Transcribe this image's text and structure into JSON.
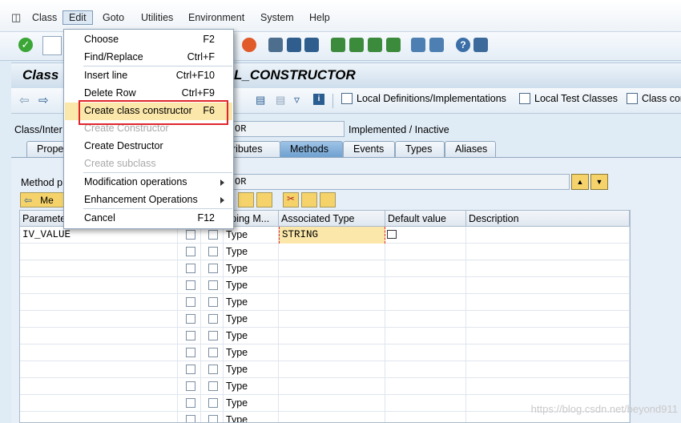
{
  "menubar": {
    "items": [
      "Class",
      "Edit",
      "Goto",
      "Utilities",
      "Environment",
      "System",
      "Help"
    ],
    "active": "Edit"
  },
  "title": "Class ",
  "title_suffix": "L_CONSTRUCTOR",
  "app_toolbar": {
    "local_defs": "Local Definitions/Implementations",
    "local_test": "Local Test Classes",
    "class_cons": "Class cons"
  },
  "class_row": {
    "label": "Class/Inter",
    "value": "OR",
    "status": "Implemented / Inactive"
  },
  "tabs": [
    "Prope",
    "ttributes",
    "Methods",
    "Events",
    "Types",
    "Aliases"
  ],
  "selected_tab": "Methods",
  "method_row": {
    "label": "Method p",
    "value": "OR",
    "back_label": "Me"
  },
  "grid": {
    "headers": [
      "Paramete",
      "",
      "",
      "yping M...",
      "Associated Type",
      "Default value",
      "Description"
    ],
    "rows": [
      {
        "param": "IV_VALUE",
        "typing": "Type",
        "assoc": "STRING"
      },
      {
        "param": "",
        "typing": "Type",
        "assoc": ""
      },
      {
        "param": "",
        "typing": "Type",
        "assoc": ""
      },
      {
        "param": "",
        "typing": "Type",
        "assoc": ""
      },
      {
        "param": "",
        "typing": "Type",
        "assoc": ""
      },
      {
        "param": "",
        "typing": "Type",
        "assoc": ""
      },
      {
        "param": "",
        "typing": "Type",
        "assoc": ""
      },
      {
        "param": "",
        "typing": "Type",
        "assoc": ""
      },
      {
        "param": "",
        "typing": "Type",
        "assoc": ""
      },
      {
        "param": "",
        "typing": "Type",
        "assoc": ""
      },
      {
        "param": "",
        "typing": "Type",
        "assoc": ""
      },
      {
        "param": "",
        "typing": "Type",
        "assoc": ""
      }
    ]
  },
  "edit_menu": {
    "items": [
      {
        "label": "Choose",
        "key": "F2",
        "enabled": true
      },
      {
        "label": "Find/Replace",
        "key": "Ctrl+F",
        "enabled": true
      },
      {
        "label": "Insert line",
        "key": "Ctrl+F10",
        "enabled": true
      },
      {
        "label": "Delete Row",
        "key": "Ctrl+F9",
        "enabled": true
      },
      {
        "label": "Create class constructor",
        "key": "F6",
        "enabled": true,
        "highlighted": true
      },
      {
        "label": "Create Constructor",
        "key": "",
        "enabled": false
      },
      {
        "label": "Create Destructor",
        "key": "",
        "enabled": true
      },
      {
        "label": "Create subclass",
        "key": "",
        "enabled": false
      },
      {
        "label": "Modification operations",
        "key": "",
        "enabled": true,
        "submenu": true
      },
      {
        "label": "Enhancement Operations",
        "key": "",
        "enabled": true,
        "submenu": true
      },
      {
        "label": "Cancel",
        "key": "F12",
        "enabled": true
      }
    ]
  },
  "watermark": "https://blog.csdn.net/beyond911",
  "colors": {
    "highlight": "#fbe7a9",
    "red_box": "#e0262b",
    "tab_selected": "#7fb0dc"
  }
}
